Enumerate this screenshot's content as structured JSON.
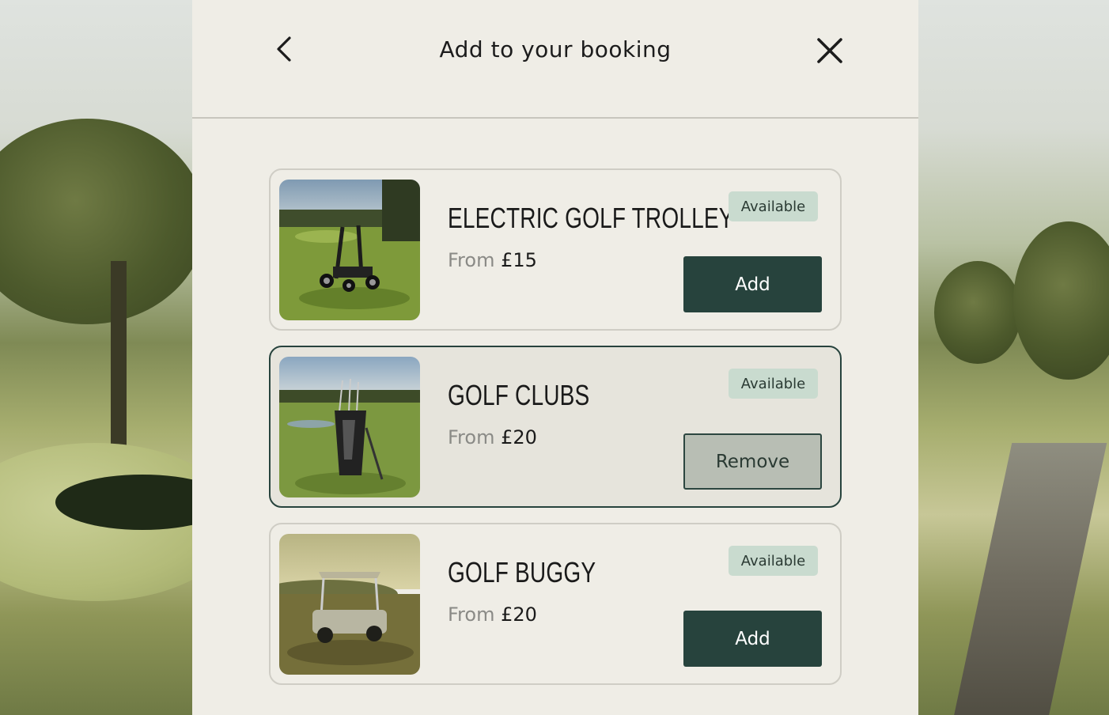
{
  "header": {
    "title": "Add to your booking",
    "back_icon": "chevron-left-icon",
    "close_icon": "close-icon"
  },
  "items": [
    {
      "name": "ELECTRIC GOLF TROLLEY",
      "price_prefix": "From",
      "price": "£15",
      "status": "Available",
      "action": "Add",
      "selected": false,
      "image": "electric-golf-trolley-photo"
    },
    {
      "name": "GOLF CLUBS",
      "price_prefix": "From",
      "price": "£20",
      "status": "Available",
      "action": "Remove",
      "selected": true,
      "image": "golf-clubs-bag-photo"
    },
    {
      "name": "GOLF BUGGY",
      "price_prefix": "From",
      "price": "£20",
      "status": "Available",
      "action": "Add",
      "selected": false,
      "image": "golf-buggy-photo"
    }
  ],
  "colors": {
    "primary": "#27433d",
    "badge_bg": "#c9dbcf",
    "panel_bg": "#efede6"
  }
}
